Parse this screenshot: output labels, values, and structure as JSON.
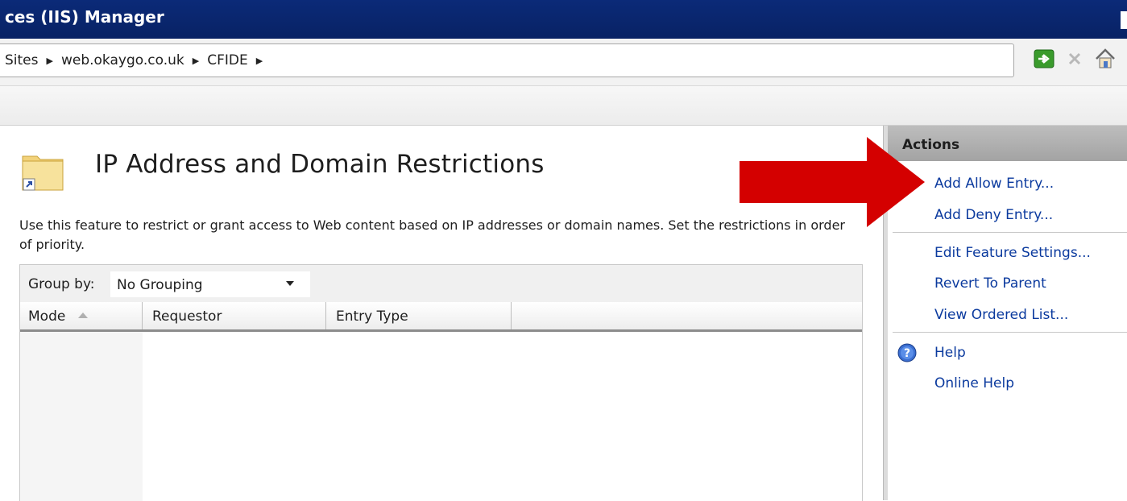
{
  "window": {
    "title": "ces (IIS) Manager"
  },
  "address": {
    "breadcrumbs": [
      "Sites",
      "web.okaygo.co.uk",
      "CFIDE"
    ],
    "separator": "▶"
  },
  "feature": {
    "title": "IP Address and Domain Restrictions",
    "description": "Use this feature to restrict or grant access to Web content based on IP addresses or domain names. Set the restrictions in order of priority."
  },
  "list": {
    "group_by_label": "Group by:",
    "group_by_value": "No Grouping",
    "columns": [
      "Mode",
      "Requestor",
      "Entry Type"
    ],
    "rows": []
  },
  "actions": {
    "title": "Actions",
    "group1": [
      "Add Allow Entry...",
      "Add Deny Entry..."
    ],
    "group2": [
      "Edit Feature Settings...",
      "Revert To Parent",
      "View Ordered List..."
    ],
    "group3": [
      "Help",
      "Online Help"
    ]
  },
  "colors": {
    "titlebar": "#0b2a78",
    "link": "#0b3a9e",
    "arrow": "#d40000",
    "actions_header": "#b0b0b0"
  },
  "icons": [
    "go-icon",
    "stop-icon",
    "home-icon",
    "folder-shortcut-icon",
    "help-icon",
    "sort-ascending-icon",
    "dropdown-arrow-icon"
  ]
}
